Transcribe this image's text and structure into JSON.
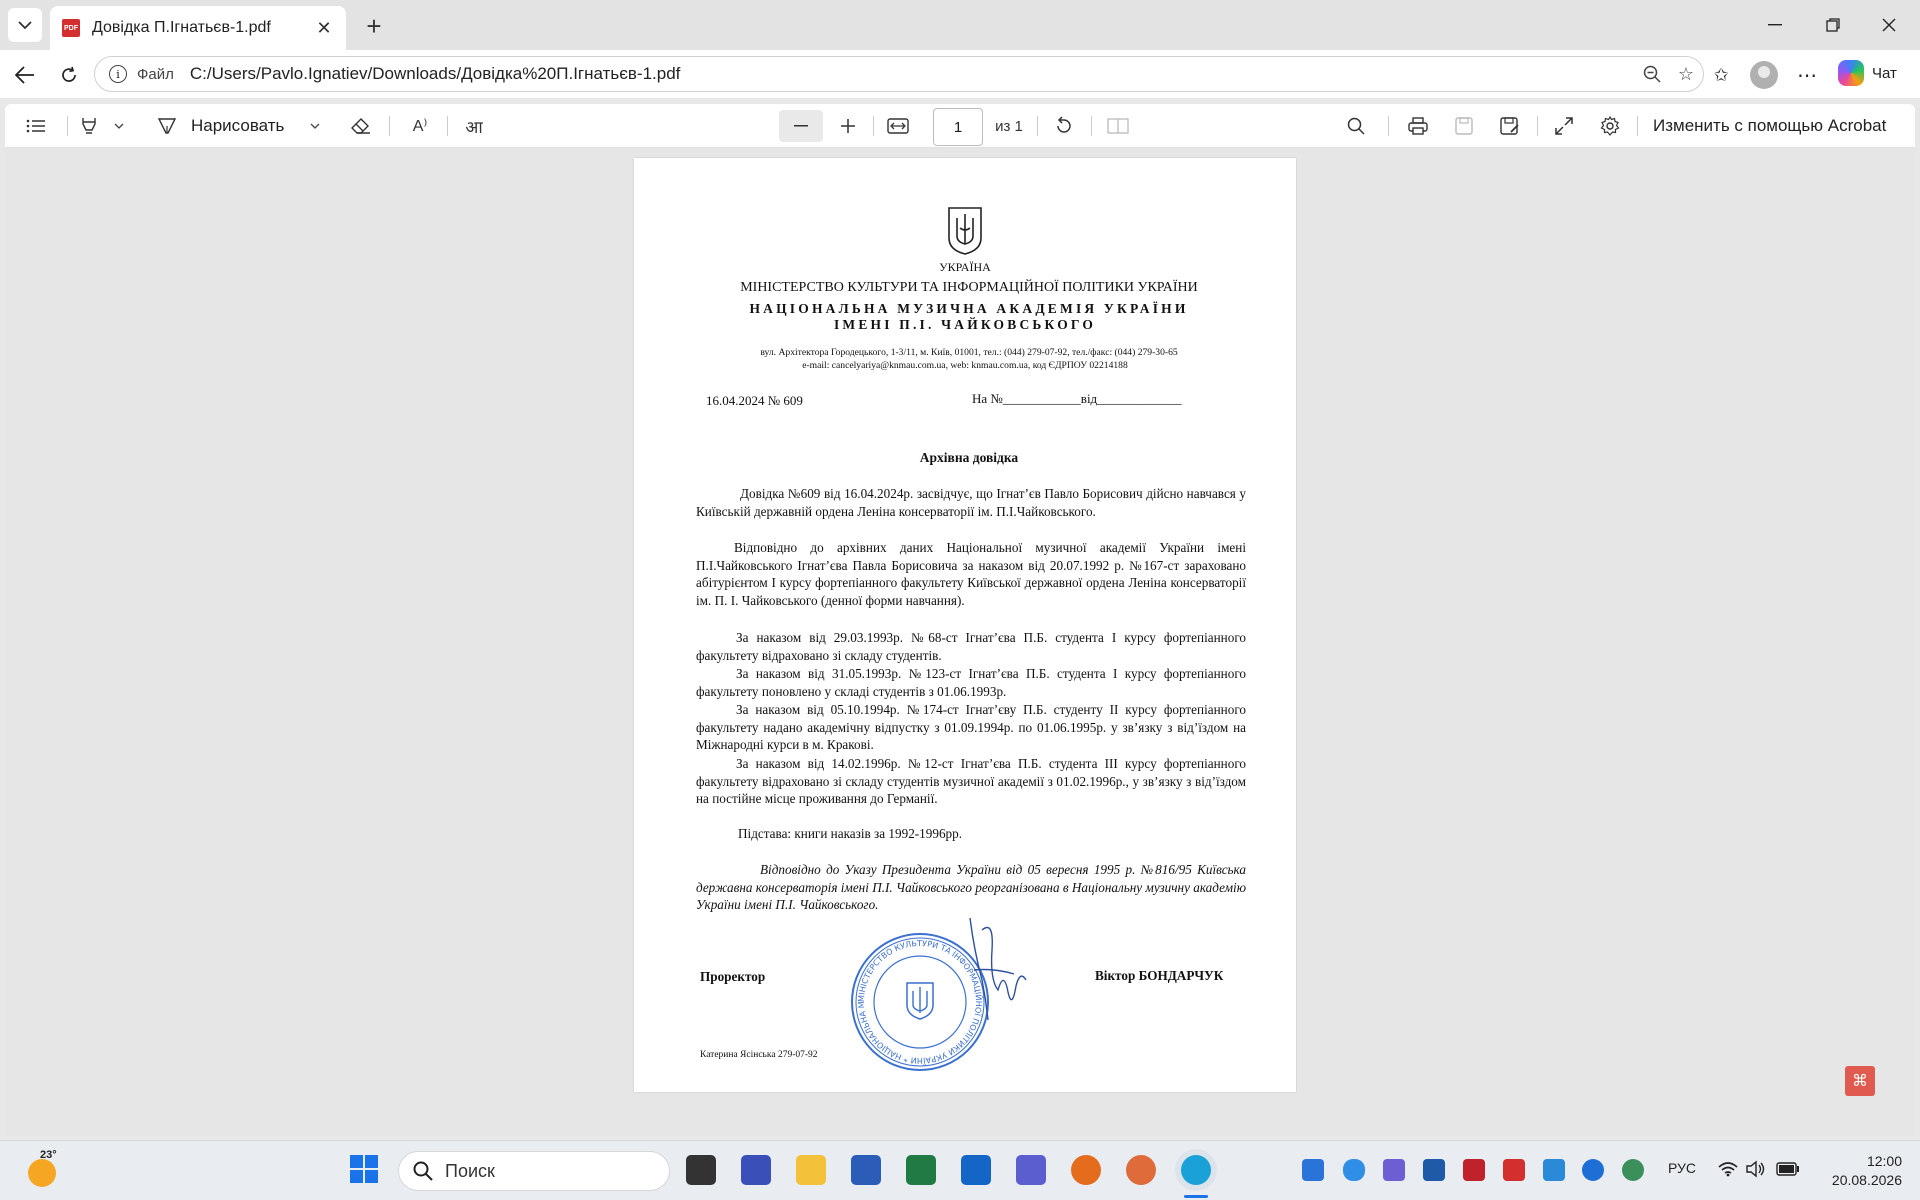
{
  "browser": {
    "tab": {
      "title": "Довідка П.Ігнатьєв-1.pdf",
      "icon": "pdf-icon"
    },
    "address": {
      "scheme": "Файл",
      "url": "C:/Users/Pavlo.Ignatiev/Downloads/Довідка%20П.Ігнатьєв-1.pdf"
    },
    "copilot_label": "Чат"
  },
  "toolbar": {
    "draw_label": "Нарисовать",
    "page_current": "1",
    "page_total": "из 1",
    "acrobat_label": "Изменить с помощью Acrobat"
  },
  "document": {
    "country": "УКРАЇНА",
    "ministry": "МІНІСТЕРСТВО КУЛЬТУРИ ТА ІНФОРМАЦІЙНОЇ ПОЛІТИКИ УКРАЇНИ",
    "academy_line1": "НАЦІОНАЛЬНА МУЗИЧНА АКАДЕМІЯ УКРАЇНИ",
    "academy_line2": "ІМЕНІ П.І. ЧАЙКОВСЬКОГО",
    "address_line1": "вул. Архітектора Городецького, 1-3/11, м. Київ, 01001, тел.: (044) 279-07-92, тел./факс: (044) 279-30-65",
    "address_line2": "e-mail: cancelyariya@knmau.com.ua, web: knmau.com.ua, код ЄДРПОУ 02214188",
    "ref_date": "16.04.2024 № 609",
    "ref_reply": "На №____________від_____________",
    "heading": "Архівна довідка",
    "paragraphs": [
      "Довідка №609 від 16.04.2024р. засвідчує, що Ігнат’єв  Павло Борисович дійсно навчався у  Київській державній ордена Леніна консерваторії ім. П.І.Чайковського.",
      "Відповідно до архівних даних Національної музичної академії України імені П.І.Чайковського  Ігнат’єва  Павла Борисовича  за наказом від 20.07.1992 р. №167-ст зараховано абітурієнтом  І курсу  фортепіанного факультету Київської державної ордена Леніна консерваторії ім. П. І. Чайковського (денної форми навчання).",
      "За наказом від 29.03.1993р. №68-ст Ігнат’єва П.Б. студента І курсу фортепіанного факультету відраховано зі складу студентів.",
      "За наказом від 31.05.1993р. №123-ст Ігнат’єва П.Б. студента І курсу фортепіанного факультету поновлено у складі студентів з 01.06.1993р.",
      "За наказом від 05.10.1994р. №174-ст Ігнат’єву П.Б. студенту ІІ курсу фортепіанного факультету надано академічну відпустку з 01.09.1994р. по 01.06.1995р. у зв’язку з від’їздом на Міжнародні курси в м. Кракові.",
      "За наказом від 14.02.1996р. №12-ст Ігнат’єва П.Б. студента ІІІ курсу фортепіанного факультету відраховано зі складу студентів музичної академії з 01.02.1996р., у зв’язку з від’їздом на постійне місце проживання до Германії."
    ],
    "basis": "Підстава: книги наказів за 1992-1996рр.",
    "note": "Відповідно до Указу Президента України від 05 вересня 1995 р. №816/95 Київська державна консерваторія імені П.І. Чайковського реорганізована в Національну музичну академію України імені П.І. Чайковського.",
    "signer_title": "Проректор",
    "signer_name": "Віктор БОНДАРЧУК",
    "executor": "Катерина Ясінська 279-07-92",
    "stamp_text": "МІНІСТЕРСТВО КУЛЬТУРИ ТА ІНФОРМАЦІЙНОЇ ПОЛІТИКИ УКРАЇНИ * НАЦІОНАЛЬНА МУЗИЧНА АКАДЕМІЯ УКРАЇНИ ІМЕНІ П.І. ЧАЙКОВСЬКОГО *"
  },
  "taskbar": {
    "temperature": "23°",
    "search_placeholder": "Поиск",
    "language": "РУС",
    "time": "12:00",
    "date": "20.08.2026"
  },
  "colors": {
    "accent_blue": "#1a73e8",
    "stamp_blue": "#3b6fd0",
    "pdf_red": "#d32f2f"
  }
}
